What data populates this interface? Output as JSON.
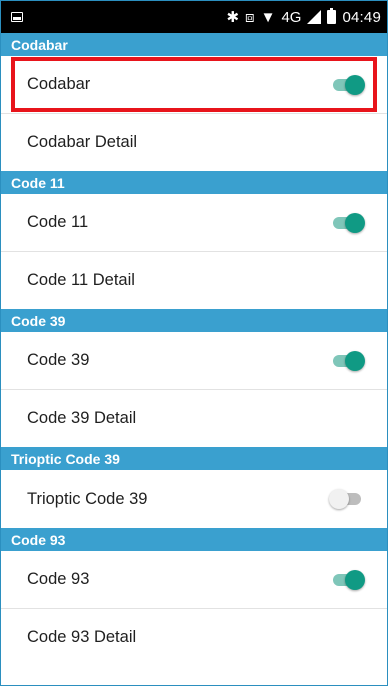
{
  "status_bar": {
    "icons": [
      "notification-icon",
      "bluetooth-icon",
      "vibrate-icon",
      "wifi-icon",
      "signal-icon",
      "battery-icon"
    ],
    "network": "4G",
    "time": "04:49"
  },
  "colors": {
    "section_header": "#3aa0cf",
    "toggle_on": "#109a84",
    "highlight": "#e8141b"
  },
  "sections": [
    {
      "header": "Codabar",
      "toggle_label": "Codabar",
      "toggle_on": true,
      "detail_label": "Codabar Detail"
    },
    {
      "header": "Code 11",
      "toggle_label": "Code 11",
      "toggle_on": true,
      "detail_label": "Code 11 Detail"
    },
    {
      "header": "Code 39",
      "toggle_label": "Code 39",
      "toggle_on": true,
      "detail_label": "Code 39 Detail"
    },
    {
      "header": "Trioptic Code 39",
      "toggle_label": "Trioptic Code 39",
      "toggle_on": false
    },
    {
      "header": "Code 93",
      "toggle_label": "Code 93",
      "toggle_on": true,
      "detail_label": "Code 93 Detail"
    }
  ]
}
